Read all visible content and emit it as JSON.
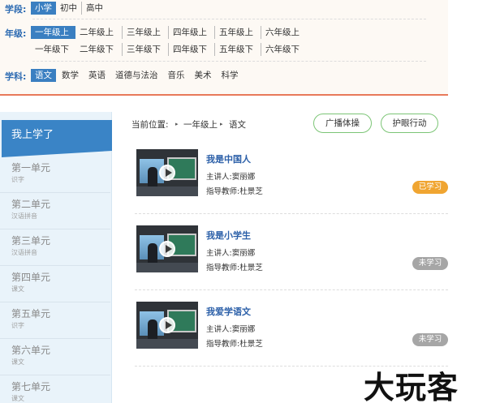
{
  "filters": {
    "stage": {
      "label": "学段:",
      "options": [
        "小学",
        "初中",
        "高中"
      ],
      "active": "小学"
    },
    "grade": {
      "label": "年级:",
      "row1": [
        "一年级上",
        "二年级上",
        "三年级上",
        "四年级上",
        "五年级上",
        "六年级上"
      ],
      "row2": [
        "一年级下",
        "二年级下",
        "三年级下",
        "四年级下",
        "五年级下",
        "六年级下"
      ],
      "active": "一年级上"
    },
    "subject": {
      "label": "学科:",
      "options": [
        "语文",
        "数学",
        "英语",
        "道德与法治",
        "音乐",
        "美术",
        "科学"
      ],
      "active": "语文"
    }
  },
  "sidebar": {
    "header": "我上学了",
    "units": [
      {
        "title": "第一单元",
        "sub": "识字"
      },
      {
        "title": "第二单元",
        "sub": "汉语拼音"
      },
      {
        "title": "第三单元",
        "sub": "汉语拼音"
      },
      {
        "title": "第四单元",
        "sub": "课文"
      },
      {
        "title": "第五单元",
        "sub": "识字"
      },
      {
        "title": "第六单元",
        "sub": "课文"
      },
      {
        "title": "第七单元",
        "sub": "课文"
      }
    ]
  },
  "breadcrumb": {
    "label": "当前位置:",
    "items": [
      "一年级上",
      "语文"
    ]
  },
  "actions": {
    "exercise": "广播体操",
    "eyecare": "护眼行动"
  },
  "lessons": [
    {
      "title": "我是中国人",
      "lecturer": "主讲人:窦丽娜",
      "advisor": "指导教师:杜景芝",
      "status": "已学习",
      "done": true
    },
    {
      "title": "我是小学生",
      "lecturer": "主讲人:窦丽娜",
      "advisor": "指导教师:杜景芝",
      "status": "未学习",
      "done": false
    },
    {
      "title": "我爱学语文",
      "lecturer": "主讲人:窦丽娜",
      "advisor": "指导教师:杜景芝",
      "status": "未学习",
      "done": false
    }
  ],
  "watermark": "大玩客",
  "colors": {
    "accent": "#3a7fc1",
    "header": "#3a84c6",
    "done": "#f0a531",
    "todo": "#a6a6a6",
    "pill_border": "#7cc576",
    "divider": "#e8795a",
    "lesson_title": "#2b5fa8"
  }
}
